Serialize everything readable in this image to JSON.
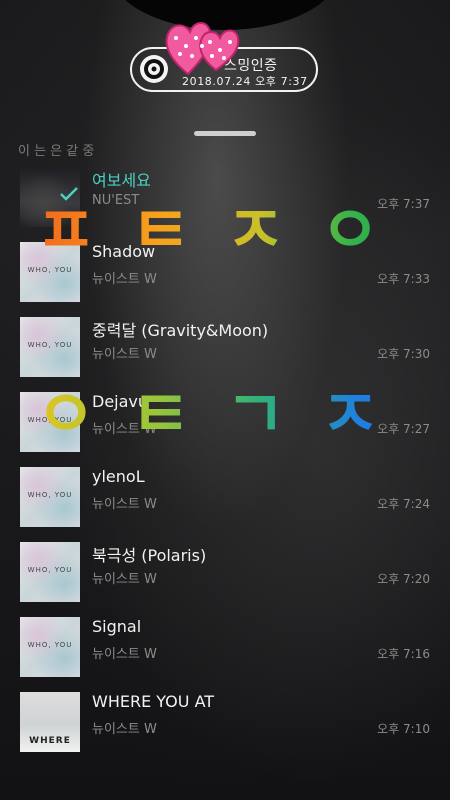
{
  "badge": {
    "title": "스밍인증",
    "date": "2018.07.24 오후 7:37"
  },
  "faint_text": "  이   는   은  같    중",
  "songs": [
    {
      "title": "여보세요",
      "artist": "NU'EST",
      "time": "오후 7:37",
      "active": true,
      "art": "dark"
    },
    {
      "title": "Shadow",
      "artist": "뉴이스트 W",
      "time": "오후 7:33",
      "active": false,
      "art": "who"
    },
    {
      "title": "중력달 (Gravity&Moon)",
      "artist": "뉴이스트 W",
      "time": "오후 7:30",
      "active": false,
      "art": "who"
    },
    {
      "title": "Dejavu",
      "artist": "뉴이스트 W",
      "time": "오후 7:27",
      "active": false,
      "art": "who"
    },
    {
      "title": "ylenoL",
      "artist": "뉴이스트 W",
      "time": "오후 7:24",
      "active": false,
      "art": "who"
    },
    {
      "title": "북극성 (Polaris)",
      "artist": "뉴이스트 W",
      "time": "오후 7:20",
      "active": false,
      "art": "who"
    },
    {
      "title": "Signal",
      "artist": "뉴이스트 W",
      "time": "오후 7:16",
      "active": false,
      "art": "who"
    },
    {
      "title": "WHERE YOU AT",
      "artist": "뉴이스트 W",
      "time": "오후 7:10",
      "active": false,
      "art": "where"
    }
  ],
  "overlay": {
    "line1": "ㅍㅌㅈㅇ",
    "line2": "ㅇㅌㄱㅈ"
  },
  "art_labels": {
    "who": "WHO, YOU",
    "where": "WHERE"
  },
  "colors": {
    "active_title": "#4ad1c1",
    "heart": "#f25aa0"
  }
}
